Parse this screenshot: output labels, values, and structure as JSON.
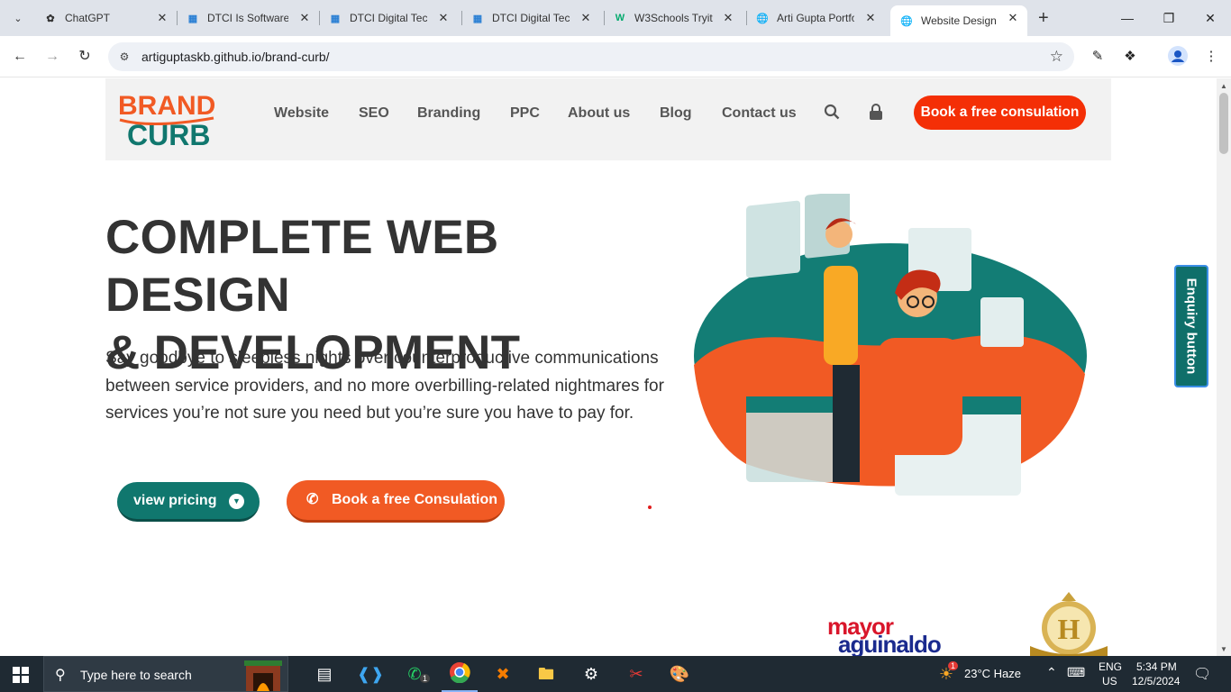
{
  "browser": {
    "tabs": [
      {
        "title": "ChatGPT",
        "icon": "chatgpt-icon"
      },
      {
        "title": "DTCI Is Software",
        "icon": "dtci-icon"
      },
      {
        "title": "DTCI Digital Tech",
        "icon": "dtci-icon"
      },
      {
        "title": "DTCI Digital Tech",
        "icon": "dtci-icon"
      },
      {
        "title": "W3Schools Tryit",
        "icon": "w3schools-icon"
      },
      {
        "title": "Arti Gupta Portfo",
        "icon": "globe-icon"
      },
      {
        "title": "Website Design",
        "icon": "globe-icon",
        "active": true
      }
    ],
    "url": "artiguptaskb.github.io/brand-curb/"
  },
  "site": {
    "logo": {
      "line1": "BRAND",
      "line2": "CURB"
    },
    "nav": [
      "Website",
      "SEO",
      "Branding",
      "PPC",
      "About us",
      "Blog",
      "Contact us"
    ],
    "header_cta": "Book a free consulation",
    "hero": {
      "title_line1": "COMPLETE WEB DESIGN",
      "title_line2": "& DEVELOPMENT",
      "text": "Say goodbye to sleepless nights over counterproductive communications between service providers, and no more overbilling-related nightmares for services you’re not sure you need but you’re sure you have to pay for.",
      "btn_pricing": "view pricing",
      "btn_consult": "Book a free Consulation"
    },
    "enquiry": "Enquiry button",
    "clients": {
      "logo1_line1": "mayor",
      "logo1_line2": "aguinaldo",
      "crest_letter": "H"
    },
    "colors": {
      "teal": "#10776e",
      "orange": "#f15a24",
      "red": "#f42f06"
    }
  },
  "taskbar": {
    "search_placeholder": "Type here to search",
    "whatsapp_badge": "1",
    "weather_badge": "1",
    "weather": "23°C  Haze",
    "lang1": "ENG",
    "lang2": "US",
    "time": "5:34 PM",
    "date": "12/5/2024"
  }
}
